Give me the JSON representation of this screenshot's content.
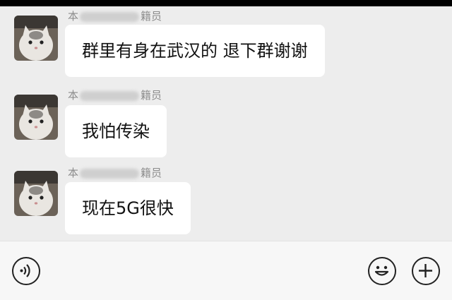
{
  "messages": [
    {
      "sender_prefix": "本",
      "sender_suffix": "籍员",
      "text": "群里有身在武汉的 退下群谢谢"
    },
    {
      "sender_prefix": "本",
      "sender_suffix": "籍员",
      "text": "我怕传染"
    },
    {
      "sender_prefix": "本",
      "sender_suffix": "籍员",
      "text": "现在5G很快"
    }
  ],
  "input_bar": {
    "voice_icon": "voice-icon",
    "emoji_icon": "emoji-icon",
    "add_icon": "plus-icon"
  }
}
